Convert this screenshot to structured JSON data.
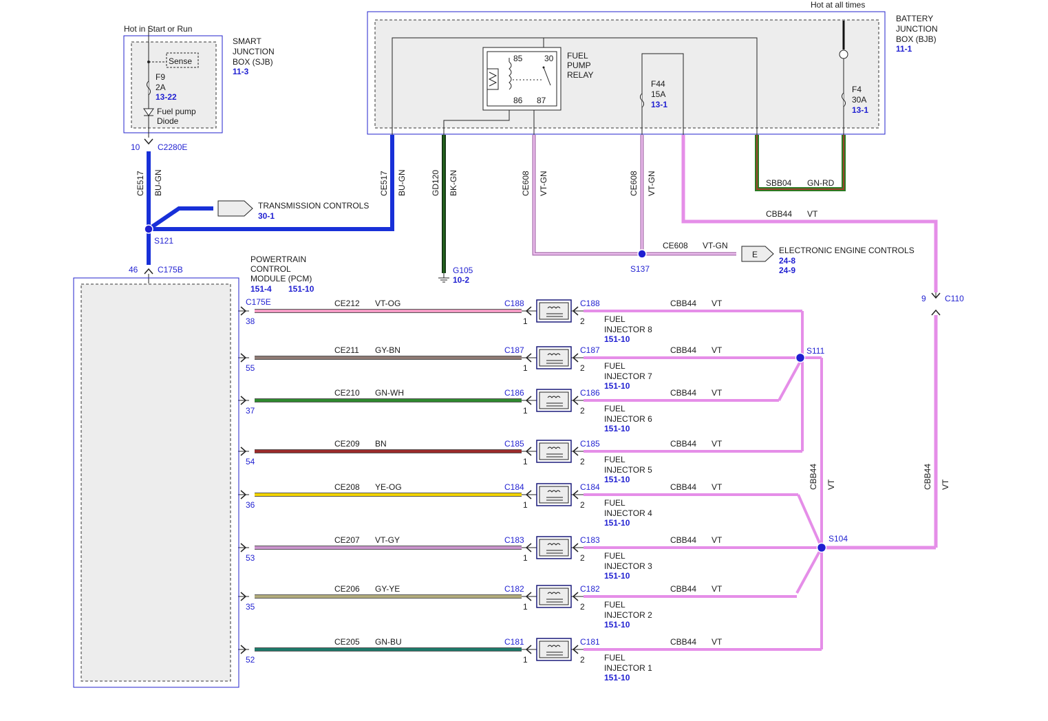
{
  "sjb": {
    "header": "Hot in Start or Run",
    "name_lines": [
      "SMART",
      "JUNCTION",
      "BOX (SJB)"
    ],
    "ref": "11-3",
    "sense": "Sense",
    "fuse_id": "F9",
    "fuse_amp": "2A",
    "fuse_ref": "13-22",
    "diode_lines": [
      "Fuel pump",
      "Diode"
    ],
    "pin": "10",
    "connector": "C2280E"
  },
  "bjb": {
    "header": "Hot at all times",
    "name_lines": [
      "BATTERY",
      "JUNCTION",
      "BOX (BJB)"
    ],
    "ref": "11-1",
    "relay_lines": [
      "FUEL",
      "PUMP",
      "RELAY"
    ],
    "relay_pins": [
      "85",
      "30",
      "86",
      "87"
    ],
    "f44_id": "F44",
    "f44_amp": "15A",
    "f44_ref": "13-1",
    "f4_id": "F4",
    "f4_amp": "30A",
    "f4_ref": "13-1"
  },
  "wires": {
    "ce517_code": "CE517",
    "ce517_color": "BU-GN",
    "gd120_code": "GD120",
    "gd120_color": "BK-GN",
    "ce608_code": "CE608",
    "ce608_color": "VT-GN",
    "sbb04_code": "SBB04",
    "sbb04_color": "GN-RD",
    "cbb44_code": "CBB44",
    "cbb44_color": "VT"
  },
  "splices": {
    "s121": "S121",
    "s137": "S137",
    "s111": "S111",
    "s104": "S104"
  },
  "ground": {
    "id": "G105",
    "ref": "10-2"
  },
  "transmission": {
    "label": "TRANSMISSION CONTROLS",
    "ref": "30-1"
  },
  "engine": {
    "letter": "E",
    "label": "ELECTRONIC ENGINE CONTROLS",
    "ref1": "24-8",
    "ref2": "24-9"
  },
  "c110": {
    "connector": "C110",
    "pin": "9"
  },
  "pcm": {
    "name_lines": [
      "POWERTRAIN",
      "CONTROL",
      "MODULE (PCM)"
    ],
    "ref1": "151-4",
    "ref2": "151-10",
    "top_pin": "46",
    "top_connector": "C175B",
    "inj_connector": "C175E"
  },
  "injector_common": {
    "label_fuel": "FUEL",
    "pin_in": "1",
    "pin_out": "2",
    "ref": "151-10"
  },
  "injectors": [
    {
      "inj": "INJ8",
      "pin": "38",
      "circuit": "CE212",
      "color": "VT-OG",
      "connector": "C188",
      "label": "INJECTOR 8"
    },
    {
      "inj": "INJ7",
      "pin": "55",
      "circuit": "CE211",
      "color": "GY-BN",
      "connector": "C187",
      "label": "INJECTOR 7"
    },
    {
      "inj": "INJ6",
      "pin": "37",
      "circuit": "CE210",
      "color": "GN-WH",
      "connector": "C186",
      "label": "INJECTOR 6"
    },
    {
      "inj": "INJ5",
      "pin": "54",
      "circuit": "CE209",
      "color": "BN",
      "connector": "C185",
      "label": "INJECTOR 5"
    },
    {
      "inj": "INJ4",
      "pin": "36",
      "circuit": "CE208",
      "color": "YE-OG",
      "connector": "C184",
      "label": "INJECTOR 4"
    },
    {
      "inj": "INJ3",
      "pin": "53",
      "circuit": "CE207",
      "color": "VT-GY",
      "connector": "C183",
      "label": "INJECTOR 3"
    },
    {
      "inj": "INJ2",
      "pin": "35",
      "circuit": "CE206",
      "color": "GY-YE",
      "connector": "C182",
      "label": "INJECTOR 2"
    },
    {
      "inj": "INJ1",
      "pin": "52",
      "circuit": "CE205",
      "color": "GN-BU",
      "connector": "C181",
      "label": "INJECTOR 1"
    }
  ],
  "colors": {
    "accent_blue": "#1f1fd1",
    "VT": "#e58ee8",
    "VT-OG": "#f29bc4",
    "GY-BN": "#8f7a74",
    "GN-WH": "#2f8a2f",
    "BN": "#9b2b2b",
    "YE-OG": "#f2d400",
    "VT-GY": "#c993cc",
    "GY-YE": "#b3ad7c",
    "GN-BU": "#1e7a6a",
    "BU-GN": "#1830d8",
    "BK-GN": "#173a17",
    "GN-RD": "#2c7a22"
  }
}
